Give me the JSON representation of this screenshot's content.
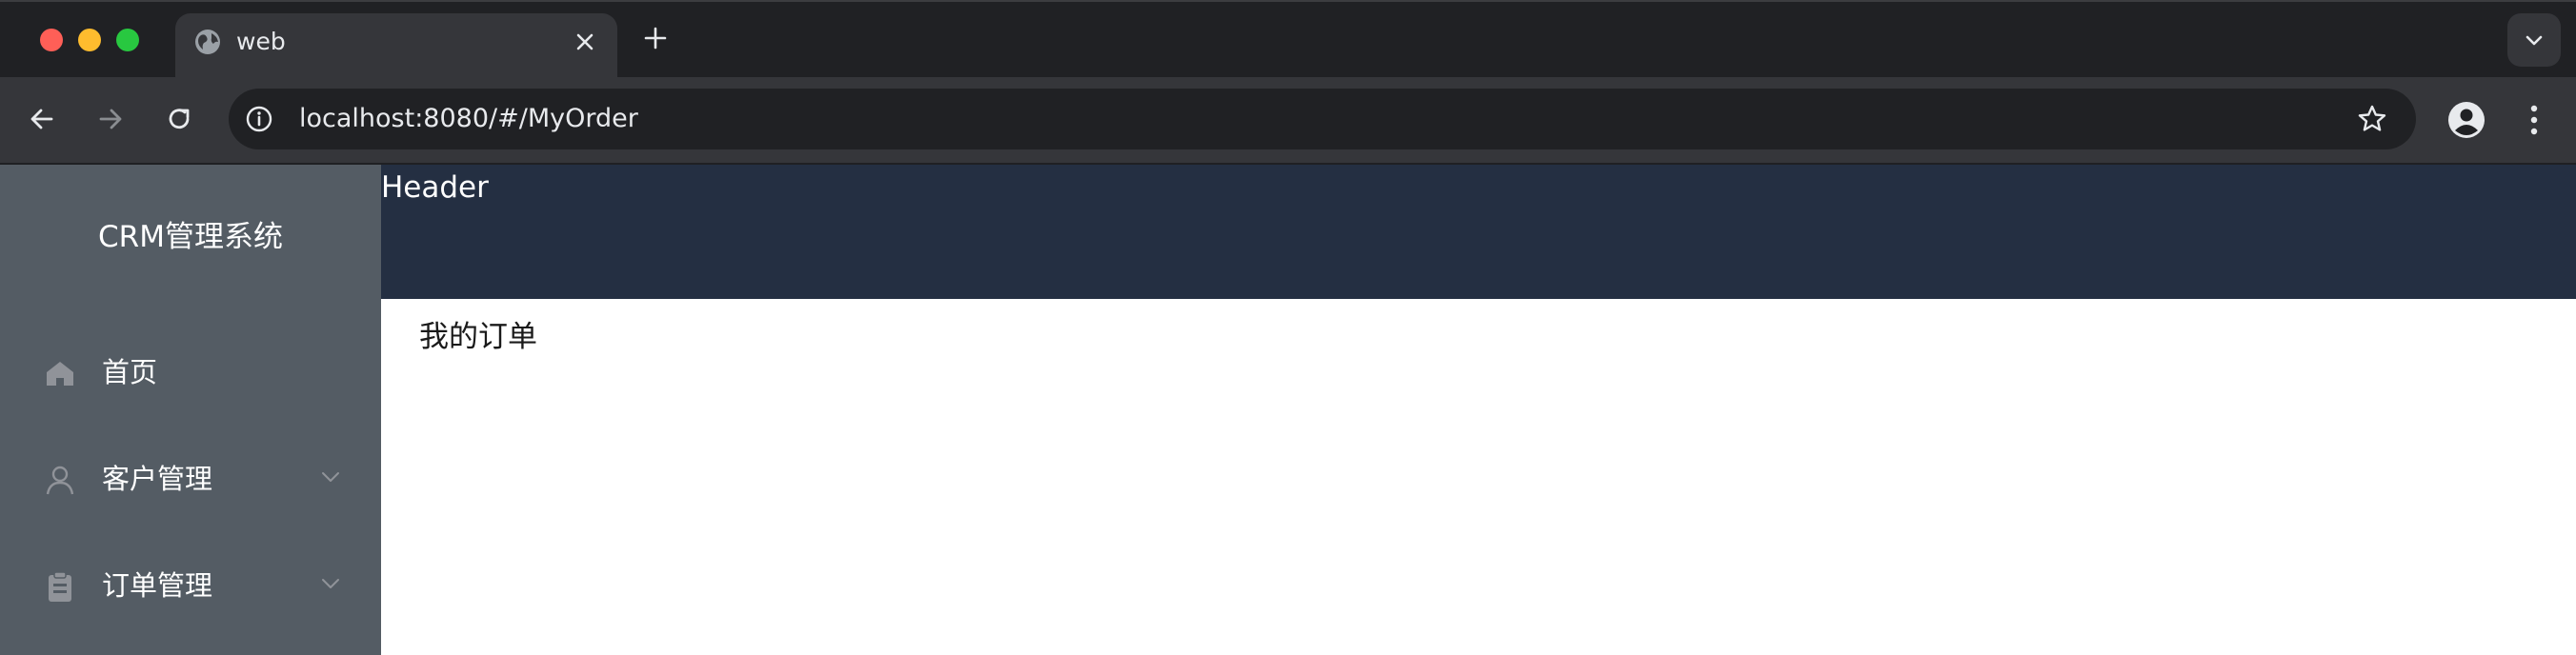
{
  "browser": {
    "tab_title": "web",
    "url": "localhost:8080/#/MyOrder",
    "icons": {
      "tab_favicon": "globe-icon",
      "tab_close": "close-icon",
      "new_tab": "plus-icon",
      "tab_search": "chevron-down-icon",
      "back": "arrow-left-icon",
      "forward": "arrow-right-icon",
      "reload": "reload-icon",
      "site_info": "info-icon",
      "bookmark": "star-icon",
      "profile": "profile-icon",
      "menu": "kebab-menu-icon"
    }
  },
  "sidebar": {
    "brand": "CRM管理系统",
    "items": [
      {
        "label": "首页",
        "icon": "home-icon",
        "has_submenu": false
      },
      {
        "label": "客户管理",
        "icon": "user-icon",
        "has_submenu": true
      },
      {
        "label": "订单管理",
        "icon": "clipboard-icon",
        "has_submenu": true
      }
    ]
  },
  "header": {
    "title": "Header"
  },
  "main": {
    "content": "我的订单"
  },
  "colors": {
    "sidebar_bg": "#545c64",
    "header_bg": "#242f42",
    "chrome_dark": "#202124",
    "chrome_toolbar": "#35363a"
  }
}
